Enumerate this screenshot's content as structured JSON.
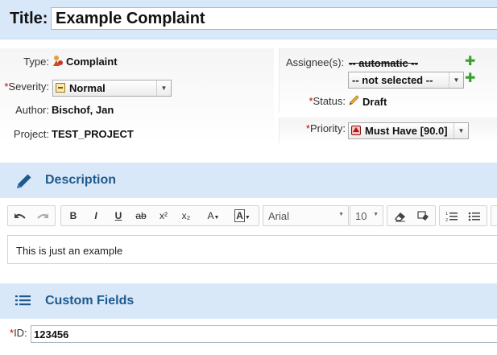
{
  "title": {
    "label": "Title:",
    "value": "Example Complaint"
  },
  "properties": {
    "type": {
      "label": "Type:",
      "value": "Complaint"
    },
    "severity": {
      "required_mark": "*",
      "label": "Severity:",
      "value": "Normal"
    },
    "author": {
      "label": "Author:",
      "value": "Bischof, Jan"
    },
    "project": {
      "label": "Project:",
      "value": "TEST_PROJECT"
    },
    "assignee": {
      "label": "Assignee(s):",
      "automatic": "-- automatic --",
      "select_value": "-- not selected --"
    },
    "status": {
      "required_mark": "*",
      "label": "Status:",
      "value": "Draft"
    },
    "priority": {
      "required_mark": "*",
      "label": "Priority:",
      "value": "Must Have [90.0]"
    }
  },
  "description": {
    "title": "Description",
    "toolbar": {
      "bold": "B",
      "italic": "I",
      "underline": "U",
      "strike": "ab",
      "superscript": "x²",
      "subscript": "x₂",
      "font_family": "Arial",
      "font_size": "10"
    },
    "content": "This is just an example"
  },
  "custom_fields": {
    "title": "Custom Fields",
    "id": {
      "required_mark": "*",
      "label": "ID:",
      "value": "123456"
    }
  },
  "colors": {
    "header_bg": "#d9e8f8",
    "header_text": "#1e5a8e",
    "required": "#cc0000",
    "add_green": "#3aa12d"
  }
}
